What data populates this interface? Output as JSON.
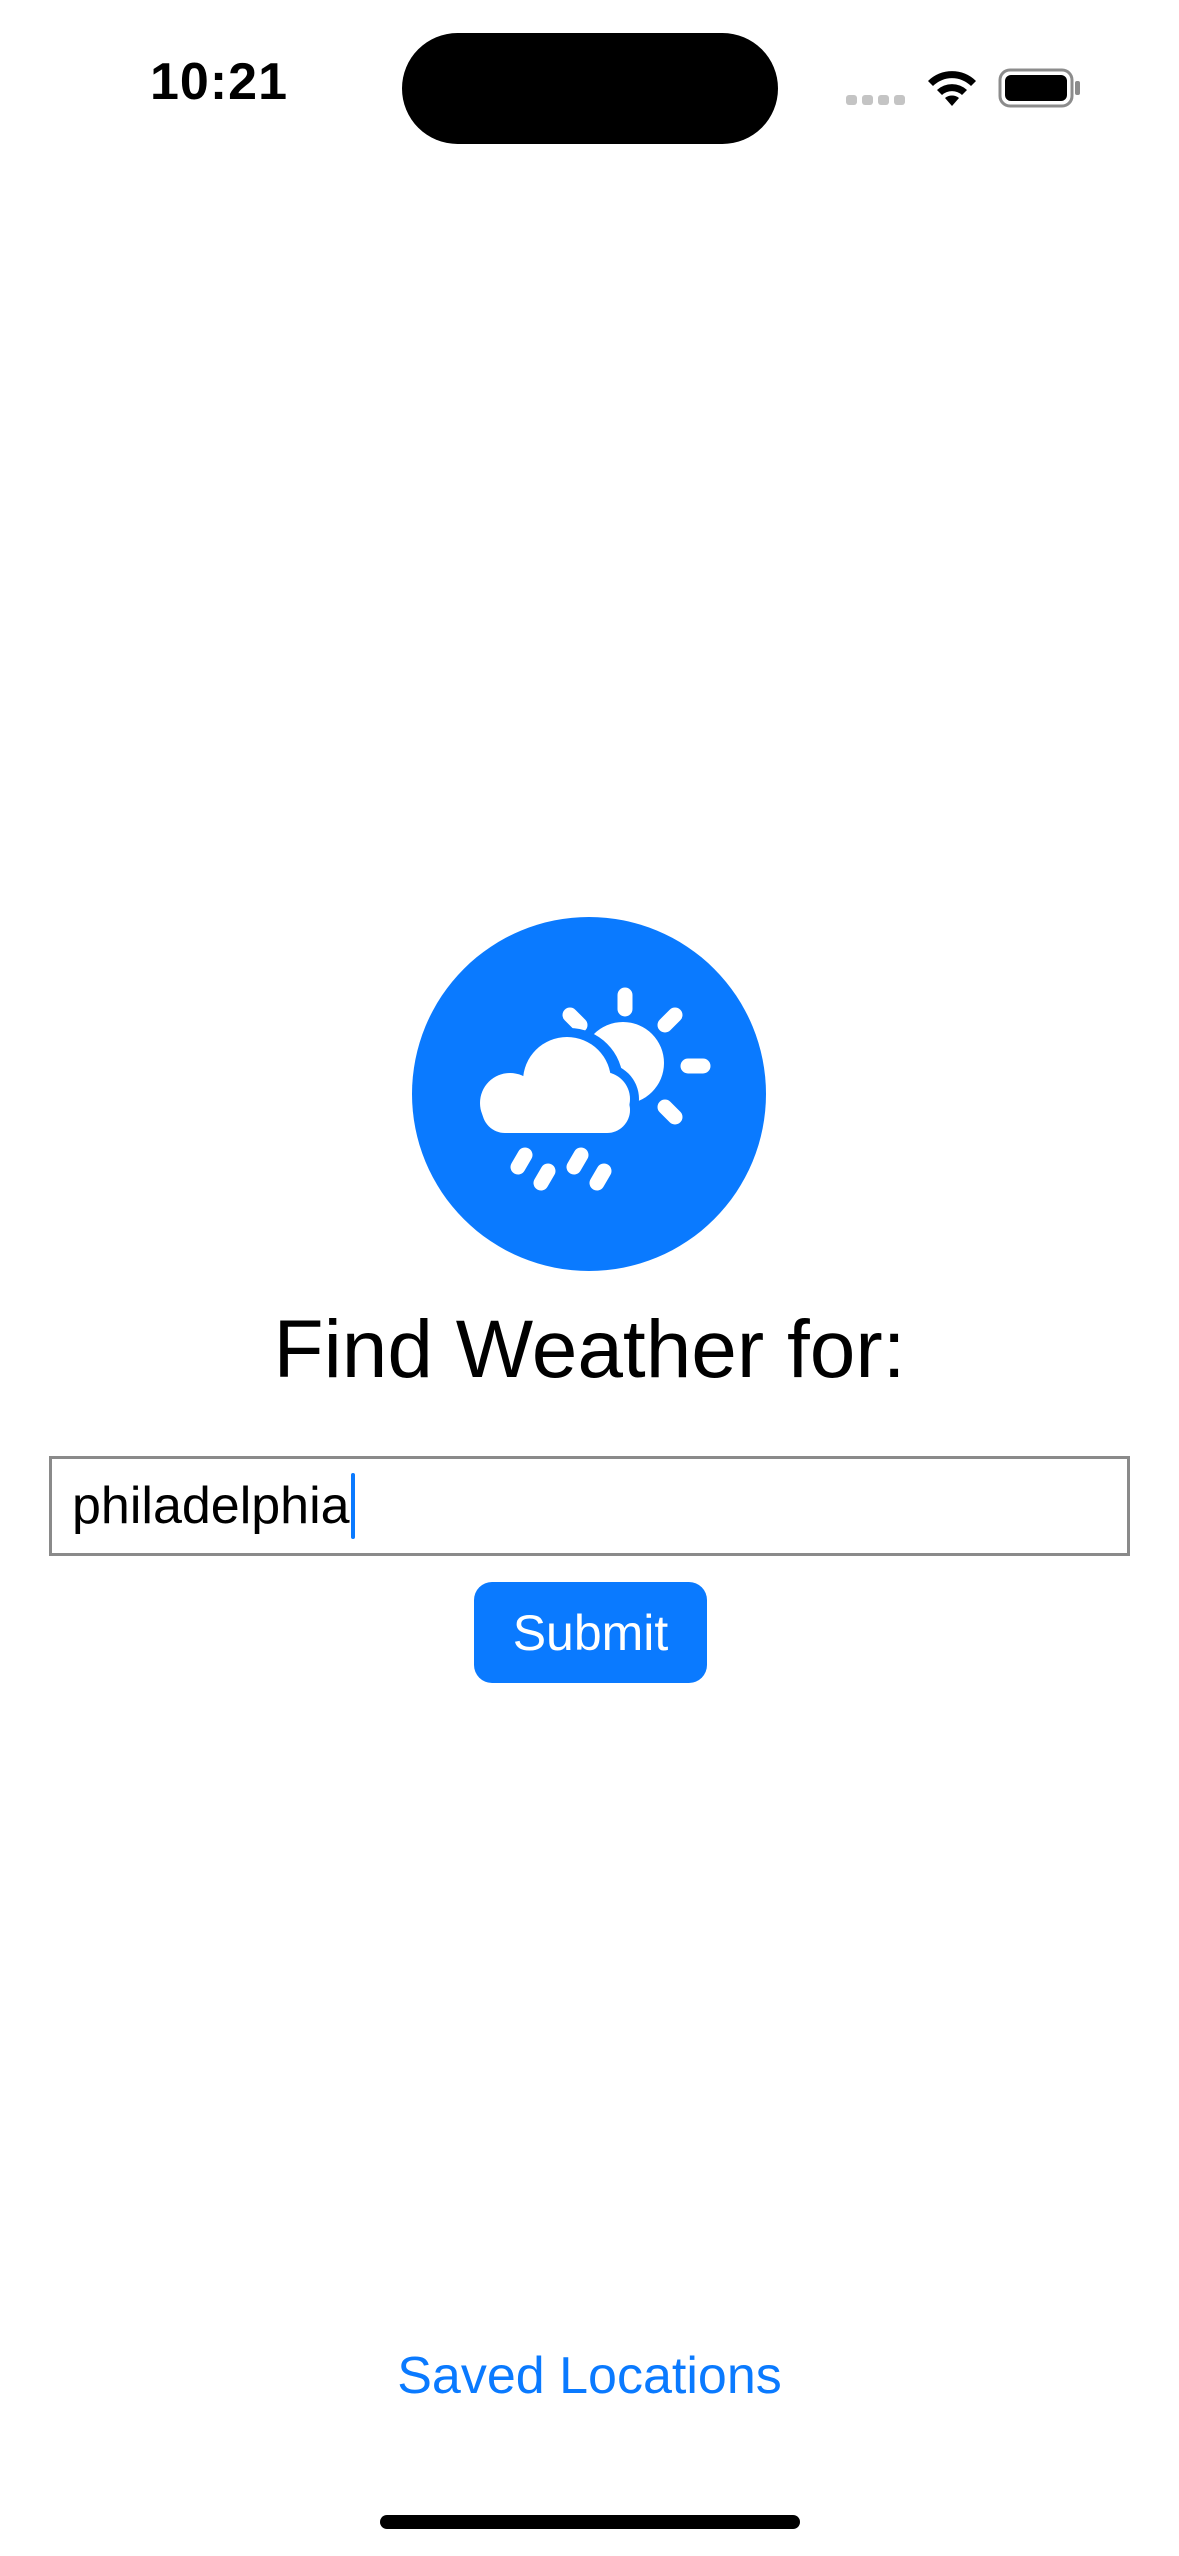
{
  "status_bar": {
    "time": "10:21"
  },
  "app": {
    "logo_icon": "sun-behind-rain-cloud-icon",
    "title": "Find Weather for:",
    "search": {
      "value": "philadelphia",
      "placeholder": ""
    },
    "submit_label": "Submit",
    "saved_locations_label": "Saved Locations"
  },
  "colors": {
    "accent": "#0a7aff",
    "input_border": "#8a8a8a",
    "background": "#ffffff"
  }
}
